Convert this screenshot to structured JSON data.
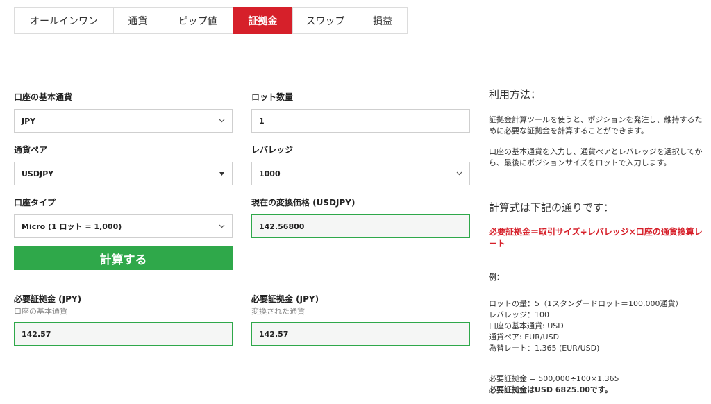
{
  "tabs": [
    {
      "label": "オールインワン",
      "active": false
    },
    {
      "label": "通貨",
      "active": false
    },
    {
      "label": "ピップ値",
      "active": false
    },
    {
      "label": "証拠金",
      "active": true
    },
    {
      "label": "スワップ",
      "active": false
    },
    {
      "label": "損益",
      "active": false
    }
  ],
  "form": {
    "base_currency": {
      "label": "口座の基本通貨",
      "value": "JPY"
    },
    "lots": {
      "label": "ロット数量",
      "value": "1"
    },
    "pair": {
      "label": "通貨ペア",
      "value": "USDJPY"
    },
    "leverage": {
      "label": "レバレッジ",
      "value": "1000"
    },
    "account_type": {
      "label": "口座タイプ",
      "value": "Micro (1 ロット = 1,000)"
    },
    "rate": {
      "label": "現在の変換価格 (USDJPY)",
      "value": "142.56800"
    },
    "calculate_label": "計算する",
    "result_base": {
      "label": "必要証拠金 (JPY)",
      "sublabel": "口座の基本通貨",
      "value": "142.57"
    },
    "result_converted": {
      "label": "必要証拠金 (JPY)",
      "sublabel": "変換された通貨",
      "value": "142.57"
    }
  },
  "info": {
    "usage_title": "利用方法：",
    "usage_p1": "証拠金計算ツールを使うと、ポジションを発注し、維持するために必要な証拠金を計算することができます。",
    "usage_p2": "口座の基本通貨を入力し、通貨ペアとレバレッジを選択してから、最後にポジションサイズをロットで入力します。",
    "formula_title": "計算式は下記の通りです：",
    "formula": "必要証拠金＝取引サイズ÷レバレッジ×口座の通貨換算レート",
    "example_title": "例：",
    "example_lines": [
      "ロットの量：5（1スタンダードロット＝100,000通貨）",
      "レバレッジ：100",
      "口座の基本通貨: USD",
      "通貨ペア: EUR/USD",
      "為替レート：1.365 (EUR/USD)"
    ],
    "calc_line": "必要証拠金 = 500,000÷100×1.365",
    "result_line": "必要証拠金はUSD 6825.00です。"
  },
  "colors": {
    "accent_red": "#d6202a",
    "accent_green": "#2fa84a"
  },
  "icons": {
    "dropdown": "chevron-down-icon",
    "select_arrow": "caret-down-icon"
  }
}
